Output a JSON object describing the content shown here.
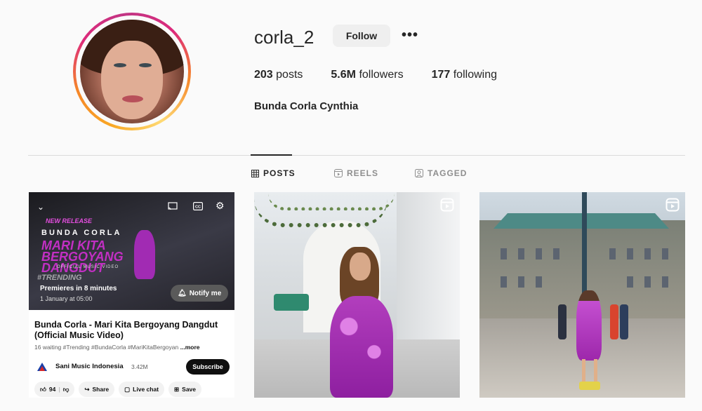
{
  "profile": {
    "username": "corla_2",
    "follow_label": "Follow",
    "more_label": "•••",
    "posts_count": "203",
    "posts_label": "posts",
    "followers_count": "5.6M",
    "followers_label": "followers",
    "following_count": "177",
    "following_label": "following",
    "full_name": "Bunda Corla Cynthia"
  },
  "tabs": {
    "posts": "POSTS",
    "reels": "REELS",
    "tagged": "TAGGED",
    "active": "posts"
  },
  "post1": {
    "artwork": {
      "new_release": "NEW RELEASE",
      "artist": "BUNDA CORLA",
      "song": "MARI KITA BERGOYANG DANGDUT",
      "subtitle": "OFFICIAL MUSIC VIDEO",
      "trending": "#TRENDING"
    },
    "premiere_text": "Premieres in 8 minutes",
    "premiere_date": "1 January at 05:00",
    "notify_label": "Notify me",
    "video_title": "Bunda Corla - Mari Kita Bergoyang Dangdut (Official Music Video)",
    "meta_waiting": "16 waiting",
    "meta_tags": "#Trending #BundaCorla #MariKitaBergoyan",
    "meta_more": "...more",
    "channel_name": "Sani Music Indonesia",
    "channel_subs": "3.42M",
    "subscribe_label": "Subscribe",
    "likes": "94",
    "share_label": "Share",
    "live_chat_label": "Live chat",
    "save_label": "Save"
  },
  "colors": {
    "accent_dress": "#a12bb3",
    "ring_start": "#f9a825",
    "ring_end": "#c13584"
  }
}
